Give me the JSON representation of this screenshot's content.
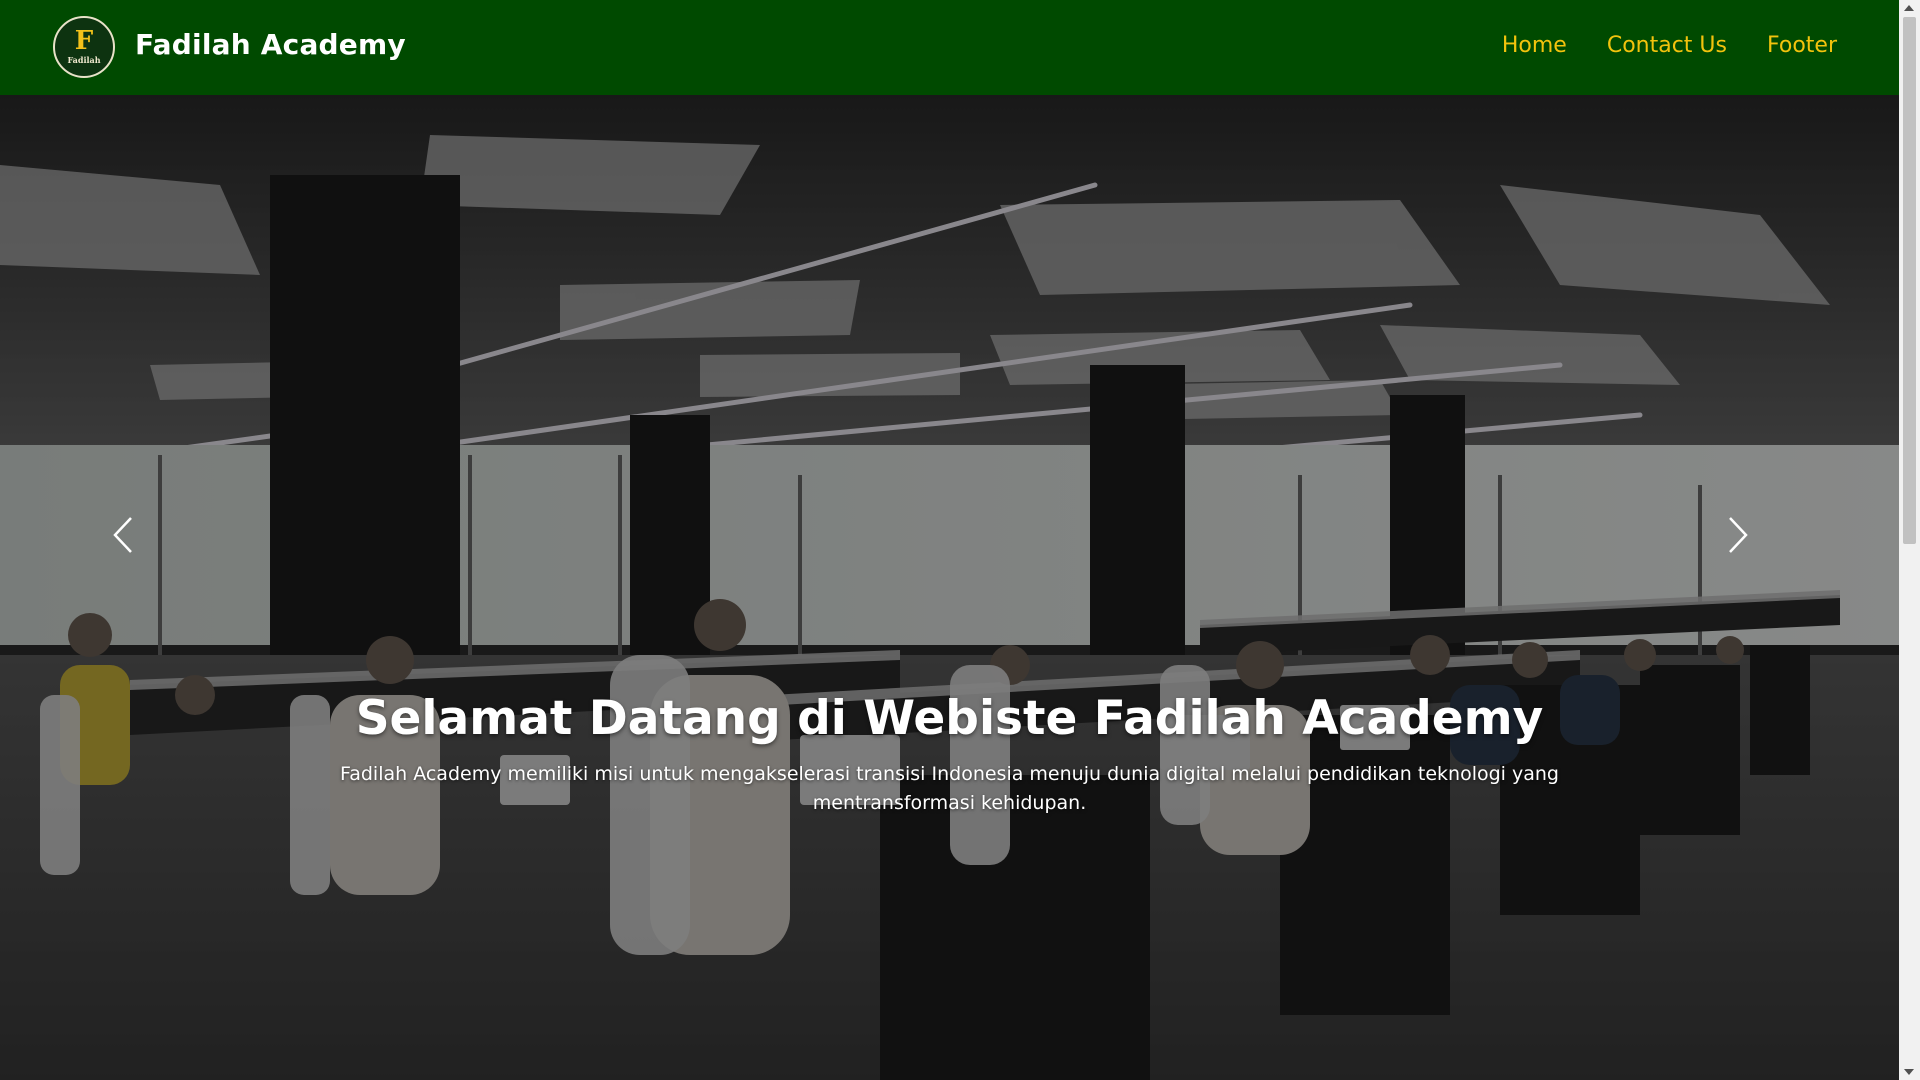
{
  "navbar": {
    "brand_name": "Fadilah Academy",
    "logo": {
      "letter": "F",
      "text": "Fadilah",
      "icon": "fadilah-logo"
    },
    "links": [
      {
        "label": "Home"
      },
      {
        "label": "Contact Us"
      },
      {
        "label": "Footer"
      }
    ]
  },
  "hero": {
    "title": "Selamat Datang di Webiste Fadilah Academy",
    "text": "Fadilah Academy memiliki misi untuk mengakselerasi transisi Indonesia menuju dunia digital melalui pendidikan teknologi yang mentransformasi kehidupan.",
    "prev_icon": "chevron-left-icon",
    "next_icon": "chevron-right-icon"
  },
  "colors": {
    "navbar_bg": "#004a00",
    "nav_link": "#f2c30d",
    "brand_text": "#ffffff"
  }
}
